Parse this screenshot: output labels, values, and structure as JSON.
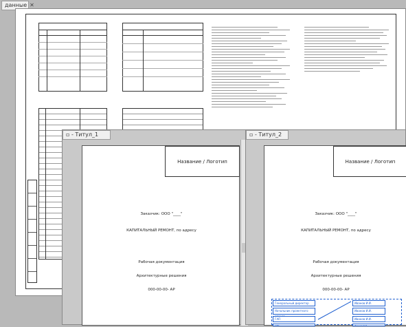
{
  "main_tab": {
    "label": "данные",
    "close": "✕"
  },
  "win1": {
    "title": "- Титул_1"
  },
  "win2": {
    "title": "- Титул_2"
  },
  "sheet": {
    "stamp": "Название / Логотип",
    "order": "Заказчик: ООО \"____\"",
    "repair": "КАПИТАЛЬНЫЙ РЕМОНТ, по адресу",
    "docs": "Рабочая документация",
    "arch": "Архитектурные решения",
    "code": "000-00-00- АР"
  },
  "sign": {
    "rows": [
      {
        "left": "Генеральный директор",
        "right": "Иванов И.И."
      },
      {
        "left": "Начальник проектного отдела",
        "right": "Иванов И.И."
      },
      {
        "left": "ГАП",
        "right": "Иванов И.И."
      },
      {
        "left": "ГИП",
        "right": "Иванов И.И."
      }
    ]
  }
}
